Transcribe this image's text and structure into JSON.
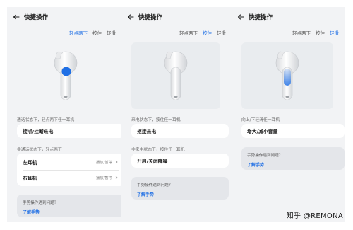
{
  "screens": [
    {
      "title": "快捷操作",
      "tabs": [
        "轻点两下",
        "按住",
        "轻滑"
      ],
      "active_tab": 0,
      "sections": [
        {
          "heading": "通话状态下，轻点两下任一耳机",
          "rows": [
            {
              "label": "接听/挂断来电",
              "value": ""
            }
          ]
        },
        {
          "heading": "非通话状态下，轻点两下",
          "rows": [
            {
              "label": "左耳机",
              "value": "播放/暂停"
            },
            {
              "label": "右耳机",
              "value": "播放/暂停"
            }
          ]
        }
      ],
      "help": {
        "question": "手势操作遇到问题？",
        "link": "了解手势"
      }
    },
    {
      "title": "快捷操作",
      "tabs": [
        "轻点两下",
        "按住",
        "轻滑"
      ],
      "active_tab": 1,
      "sections": [
        {
          "heading": "来电状态下，按住任一耳机",
          "rows": [
            {
              "label": "拒接来电",
              "value": ""
            }
          ]
        },
        {
          "heading": "非来电状态下，按住任一耳机",
          "rows": [
            {
              "label": "开启/关闭降噪",
              "value": ""
            }
          ]
        }
      ],
      "help": {
        "question": "手势操作遇到问题？",
        "link": "了解手势"
      }
    },
    {
      "title": "快捷操作",
      "tabs": [
        "轻点两下",
        "按住",
        "轻滑"
      ],
      "active_tab": 2,
      "sections": [
        {
          "heading": "向上/下轻滑任一耳机",
          "rows": [
            {
              "label": "增大/减小音量",
              "value": ""
            }
          ]
        }
      ],
      "help": {
        "question": "手势操作遇到问题？",
        "link": "了解手势"
      }
    }
  ],
  "watermark": "知乎 @REMONA",
  "icons": {
    "back": "back-arrow-icon",
    "chevron": "chevron-right-icon",
    "earbud": "earbud-illustration"
  },
  "colors": {
    "accent": "#1f6fe5",
    "background": "#f2f3f5",
    "card": "#ffffff"
  }
}
